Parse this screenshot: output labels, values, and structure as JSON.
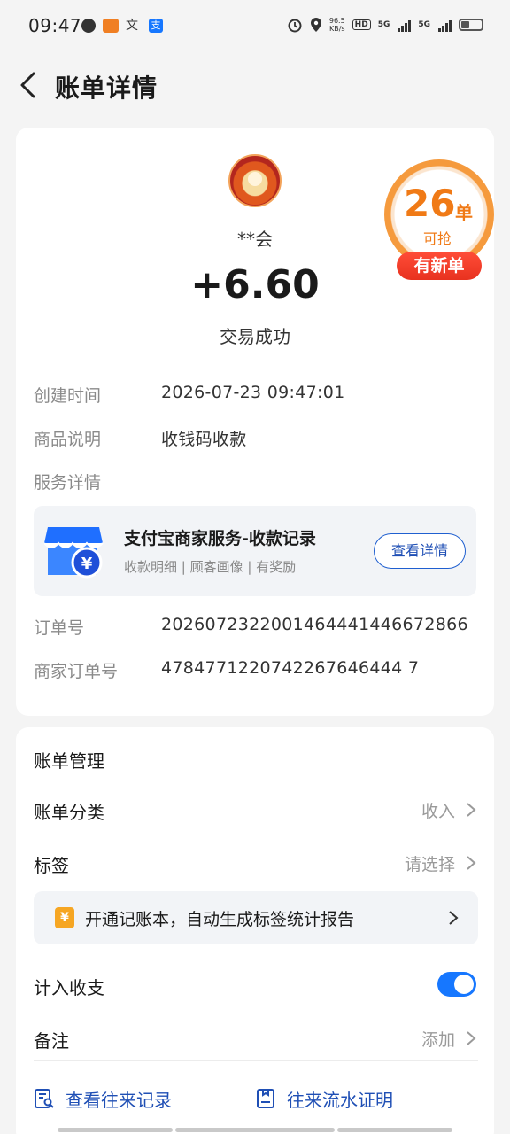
{
  "status_bar": {
    "time": "09:47",
    "speed_value": "96.5",
    "speed_unit": "KB/s",
    "hd_label": "HD",
    "net1": "5G",
    "net2": "5G",
    "alipay_glyph": "支",
    "text_glyph": "文"
  },
  "header": {
    "title": "账单详情"
  },
  "transaction": {
    "merchant": "**会",
    "amount": "+6.60",
    "status": "交易成功"
  },
  "promo_badge": {
    "count": "26",
    "unit": "单",
    "sub": "可抢",
    "pill": "有新单",
    "accent": "#f07a16",
    "pill_color": "#e8321f"
  },
  "details": {
    "created_label": "创建时间",
    "created_value": "2026-07-23 09:47:01",
    "product_label": "商品说明",
    "product_value": "收钱码收款",
    "service_label": "服务详情",
    "order_label": "订单号",
    "order_value": "2026072322001464441446672866",
    "merchant_order_label": "商家订单号",
    "merchant_order_value": "4784771220742267646444 7"
  },
  "service": {
    "title": "支付宝商家服务-收款记录",
    "subtitle": "收款明细 | 顾客画像 | 有奖励",
    "button": "查看详情",
    "icon": "shop-icon"
  },
  "management": {
    "title": "账单管理",
    "category_label": "账单分类",
    "category_value": "收入",
    "tag_label": "标签",
    "tag_value": "请选择",
    "promo_text": "开通记账本，自动生成标签统计报告",
    "promo_icon_glyph": "¥",
    "include_label": "计入收支",
    "include_on": true,
    "note_label": "备注",
    "note_value": "添加",
    "link1": "查看往来记录",
    "link2": "往来流水证明",
    "accent": "#1677ff"
  }
}
